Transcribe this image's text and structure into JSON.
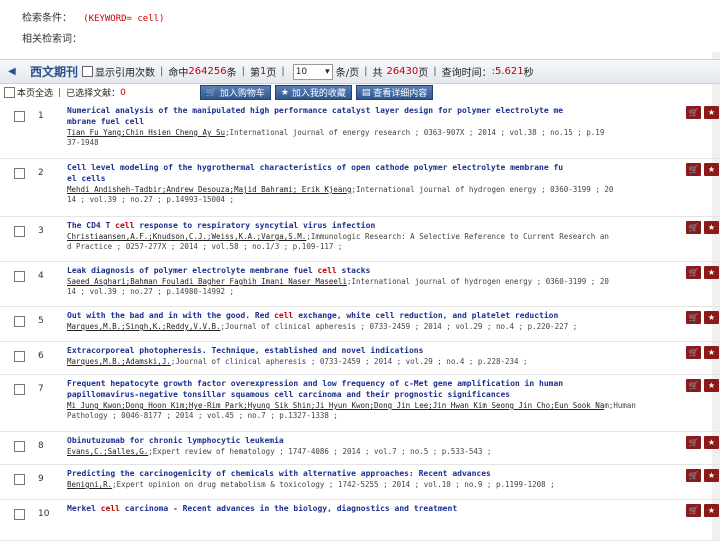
{
  "search": {
    "condition_label": "检索条件：",
    "condition_value": "(KEYWORD= cell)",
    "related_label": "相关检索词："
  },
  "tabbar": {
    "title": "西文期刊",
    "show_cite_label": "显示引用次数",
    "hits_prefix": "命中",
    "hits_count": "264256",
    "hits_suffix": "条",
    "page_prefix": "第",
    "page_num": "1",
    "page_suffix": "页",
    "per_page_value": "10",
    "per_page_suffix": "条/页",
    "total_prefix": "共",
    "total_pages": "26430",
    "total_suffix": "页",
    "time_label": "查询时间：",
    "time_value": ":5.621",
    "time_unit": "秒"
  },
  "actionbar": {
    "select_all": "本页全选",
    "selected_label": "已选择文献：",
    "selected_count": "0",
    "btn_add_cart": "加入购物车",
    "btn_add_fav": "加入我的收藏",
    "btn_view_detail": "查看详细内容"
  },
  "records": [
    {
      "num": "1",
      "title_pre": "Numerical analysis of the manipulated high performance catalyst layer design for polymer electrolyte me",
      "title_hl": "",
      "title_post": "mbrane fuel cell",
      "authors": "Tian Fu Yang;Chin Hsien Cheng Ay Su",
      "source": ";International journal of energy research ; 0363-907X ; 2014 ; vol.38 ; no.15 ; p.19",
      "source2": "37-1948"
    },
    {
      "num": "2",
      "title_pre": "Cell level modeling of the hygrothermal characteristics of open cathode polymer electrolyte membrane fu",
      "title_hl": "",
      "title_post": "el cells",
      "authors": "Mehdi Andisheh-Tadbir;Andrew Desouza;Majid Bahrami; Erik Kjeang",
      "source": ";International journal of hydrogen energy ; 0360-3199 ; 20",
      "source2": "14 ; vol.39 ; no.27 ; p.14993-15004 ;"
    },
    {
      "num": "3",
      "title_pre": "The CD4 T ",
      "title_hl": "cell",
      "title_post": " response to respiratory syncytial virus infection",
      "authors": "Christiaansen,A.F.;Knudson,C.J.;Weiss,K.A.;Varga,S.M.",
      "source": ";Immunologic Research: A Selective Reference to Current Research an",
      "source2": "d Practice ; 0257-277X ; 2014 ; vol.58 ; no.1/3 ; p.109-117 ;"
    },
    {
      "num": "4",
      "title_pre": "Leak diagnosis of polymer electrolyte membrane fuel ",
      "title_hl": "cell",
      "title_post": " stacks",
      "authors": "Saeed Asghari;Bahman Fouladi Bagher Faghih Imani Naser Maseeli",
      "source": ";International journal of hydrogen energy ; 0360-3199 ; 20",
      "source2": "14 ; vol.39 ; no.27 ; p.14980-14992 ;"
    },
    {
      "num": "5",
      "title_pre": "Out with the bad and in with the good. Red ",
      "title_hl": "cell",
      "title_post": " exchange, white cell reduction, and platelet reduction",
      "authors": "Marques,M.B.;Singh,K.;Reddy,V.V.B.",
      "source": ";Journal of clinical apheresis ; 0733-2459 ; 2014 ; vol.29 ; no.4 ; p.220-227 ;",
      "source2": ""
    },
    {
      "num": "6",
      "title_pre": "Extracorporeal photopheresis. Technique, established and novel indications",
      "title_hl": "",
      "title_post": "",
      "authors": "Marques,M.B.;Adamski,J.",
      "source": ";Journal of clinical apheresis ; 0733-2459 ; 2014 ; vol.29 ; no.4 ; p.228-234 ;",
      "source2": ""
    },
    {
      "num": "7",
      "title_pre": "Frequent hepatocyte growth factor overexpression and low frequency of c-Met gene amplification in human",
      "title_hl": "",
      "title_post": "papillomavirus-negative tonsillar squamous cell carcinoma and their prognostic significances",
      "authors": "Mi Jung Kwon;Dong Hoon Kim;Hye-Rim Park;Hyung Sik Shin;Ji Hyun Kwon;Dong Jin Lee;Jin Hwan Kim Seong Jin Cho;Eun Sook Na",
      "source": "m;Human Pathology ; 0046-8177 ; 2014 ; vol.45 ; no.7 ; p.1327-1338 ;",
      "source2": ""
    },
    {
      "num": "8",
      "title_pre": "Obinutuzumab for chronic lymphocytic leukemia",
      "title_hl": "",
      "title_post": "",
      "authors": "Evans,C.;Salles,G.",
      "source": ";Expert review of hematology ; 1747-4086 ; 2014 ; vol.7 ; no.5 ; p.533-543 ;",
      "source2": ""
    },
    {
      "num": "9",
      "title_pre": "Predicting the carcinogenicity of chemicals with alternative approaches: Recent advances",
      "title_hl": "",
      "title_post": "",
      "authors": "Benigni,R.",
      "source": ";Expert opinion on drug metabolism & toxicology ; 1742-5255 ; 2014 ; vol.10 ; no.9 ; p.1199-1208 ;",
      "source2": ""
    },
    {
      "num": "10",
      "title_pre": "Merkel ",
      "title_hl": "cell",
      "title_post": " carcinoma - Recent advances in the biology, diagnostics and treatment",
      "authors": "",
      "source": "",
      "source2": ""
    }
  ],
  "colors": {
    "accent": "#1a2f8f",
    "highlight": "#c00000",
    "icon_bg": "#8b1a1a"
  },
  "icons": {
    "cart": "cart-icon",
    "fav": "favorite-icon"
  }
}
